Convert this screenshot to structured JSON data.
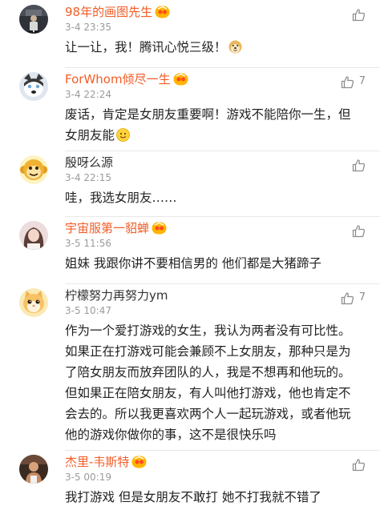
{
  "colors": {
    "vip_name": "#f35d28",
    "plain_name": "#333333",
    "time": "#9b9b9b",
    "text": "#222222",
    "divider": "#e8e8e8"
  },
  "comments": [
    {
      "name": "98年的画图先生",
      "vip": true,
      "time": "3-4 23:35",
      "lines": [
        "让一让，我！腾讯心悦三级！"
      ],
      "emoji": "doge-emoji",
      "likes": "",
      "avatar": "dark-photo-avatar"
    },
    {
      "name": "ForWhom倾尽一生",
      "vip": true,
      "time": "3-4 22:24",
      "lines": [
        "废话，肯定是女朋友重要啊！游戏不能陪你一生，但",
        "女朋友能"
      ],
      "emoji": "smile-emoji",
      "likes": "7",
      "avatar": "dog-avatar"
    },
    {
      "name": "殷呀么源",
      "vip": false,
      "time": "3-4 22:15",
      "lines": [
        "哇，我选女朋友……"
      ],
      "emoji": "",
      "likes": "",
      "avatar": "monkey-avatar"
    },
    {
      "name": "宇宙服第一貂蝉",
      "vip": true,
      "time": "3-5 11:56",
      "lines": [
        "姐妹 我跟你讲不要相信男的 他们都是大猪蹄子"
      ],
      "emoji": "",
      "likes": "",
      "avatar": "girl-photo-avatar"
    },
    {
      "name": "柠檬努力再努力ym",
      "vip": false,
      "time": "3-5 10:47",
      "lines": [
        "作为一个爱打游戏的女生，我认为两者没有可比性。",
        "如果正在打游戏可能会兼顾不上女朋友，那种只是为",
        "了陪女朋友而放弃团队的人，我是不想再和他玩的。",
        "但如果正在陪女朋友，有人叫他打游戏，他也肯定不",
        "会去的。所以我更喜欢两个人一起玩游戏，或者他玩",
        "他的游戏你做你的事，这不是很快乐吗"
      ],
      "emoji": "",
      "likes": "7",
      "avatar": "cat-avatar"
    },
    {
      "name": "杰里-韦斯特",
      "vip": true,
      "time": "3-5 00:19",
      "lines": [
        "我打游戏 但是女朋友不敢打 她不打我就不错了"
      ],
      "emoji": "",
      "likes": "",
      "avatar": "man-photo-avatar"
    }
  ]
}
